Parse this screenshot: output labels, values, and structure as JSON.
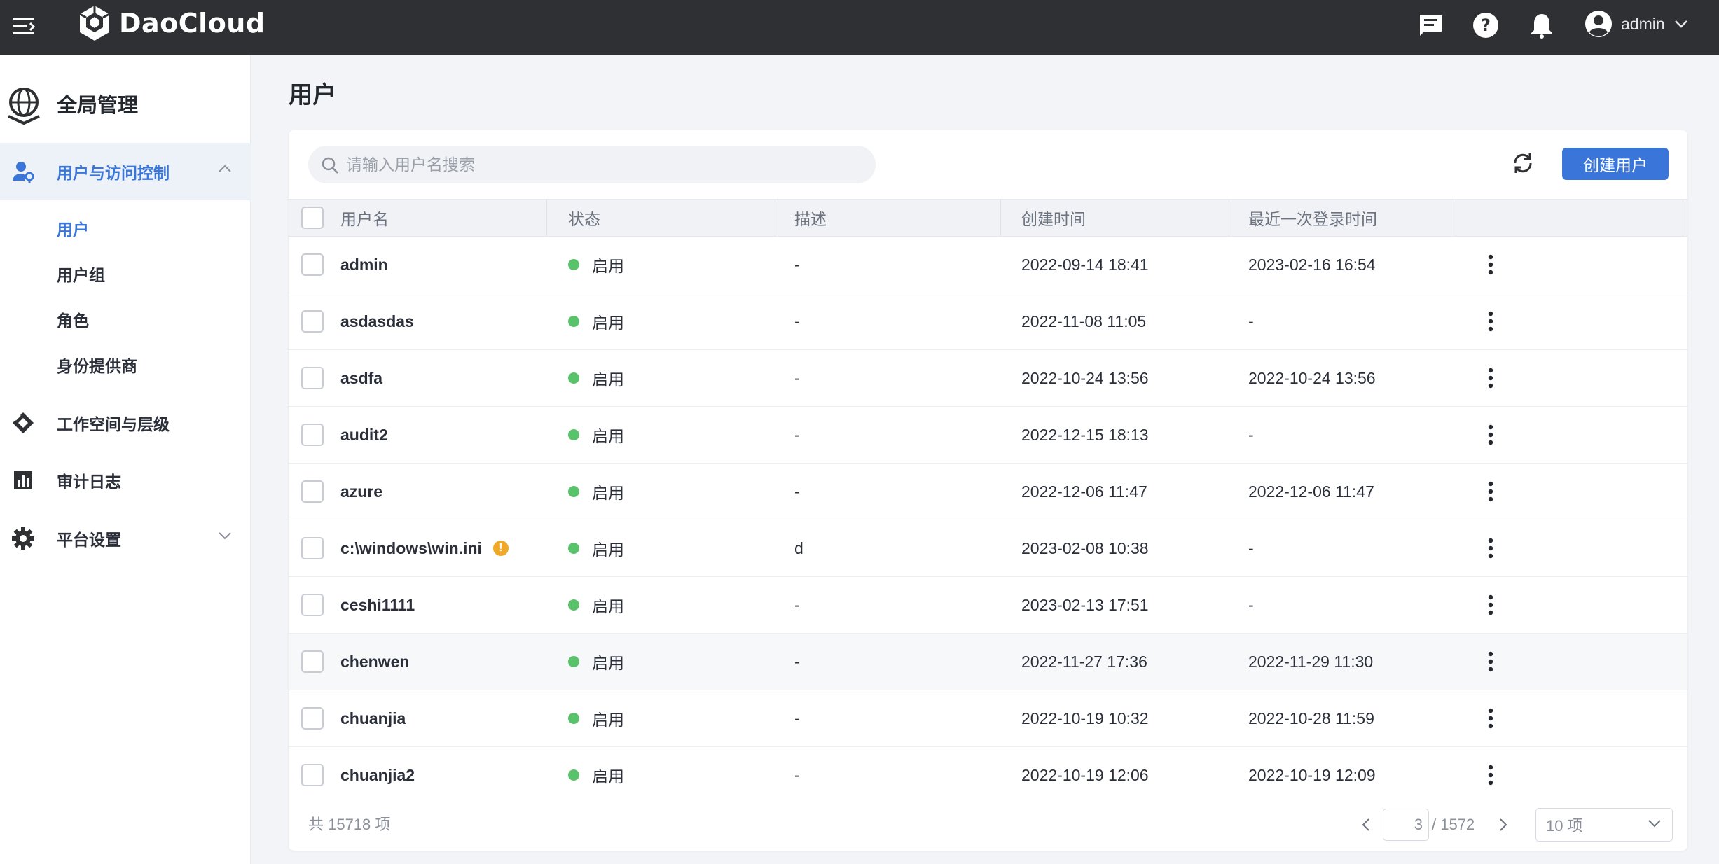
{
  "topbar": {
    "brand": "DaoCloud",
    "icons": [
      "menu-icon",
      "message-icon",
      "help-icon",
      "bell-icon",
      "user-avatar-icon",
      "chevron-down-icon"
    ],
    "user_name": "admin",
    "background": "#2e3033"
  },
  "sidebar": {
    "title": "全局管理",
    "groups": [
      {
        "label": "用户与访问控制",
        "icon": "user-key-icon",
        "expanded": true
      },
      {
        "label": "工作空间与层级",
        "icon": "layers-icon"
      },
      {
        "label": "审计日志",
        "icon": "audit-chart-icon"
      },
      {
        "label": "平台设置",
        "icon": "gear-icon",
        "expanded": false
      }
    ],
    "subitems": [
      "用户",
      "用户组",
      "角色",
      "身份提供商"
    ]
  },
  "page": {
    "title": "用户",
    "search_placeholder": "请输入用户名搜索",
    "create_button": "创建用户",
    "accent": "#3a76d9"
  },
  "table": {
    "columns": [
      "用户名",
      "状态",
      "描述",
      "创建时间",
      "最近一次登录时间"
    ],
    "rows": [
      {
        "name": "admin",
        "status": "启用",
        "desc": "-",
        "created": "2022-09-14 18:41",
        "last_login": "2023-02-16 16:54"
      },
      {
        "name": "asdasdas",
        "status": "启用",
        "desc": "-",
        "created": "2022-11-08 11:05",
        "last_login": "-"
      },
      {
        "name": "asdfa",
        "status": "启用",
        "desc": "-",
        "created": "2022-10-24 13:56",
        "last_login": "2022-10-24 13:56"
      },
      {
        "name": "audit2",
        "status": "启用",
        "desc": "-",
        "created": "2022-12-15 18:13",
        "last_login": "-"
      },
      {
        "name": "azure",
        "status": "启用",
        "desc": "-",
        "created": "2022-12-06 11:47",
        "last_login": "2022-12-06 11:47"
      },
      {
        "name": "c:\\windows\\win.ini",
        "status": "启用",
        "desc": "d",
        "created": "2023-02-08 10:38",
        "last_login": "-",
        "warning": true
      },
      {
        "name": "ceshi1111",
        "status": "启用",
        "desc": "-",
        "created": "2023-02-13 17:51",
        "last_login": "-"
      },
      {
        "name": "chenwen",
        "status": "启用",
        "desc": "-",
        "created": "2022-11-27 17:36",
        "last_login": "2022-11-29 11:30",
        "hovered": true
      },
      {
        "name": "chuanjia",
        "status": "启用",
        "desc": "-",
        "created": "2022-10-19 10:32",
        "last_login": "2022-10-28 11:59"
      },
      {
        "name": "chuanjia2",
        "status": "启用",
        "desc": "-",
        "created": "2022-10-19 12:06",
        "last_login": "2022-10-19 12:09"
      }
    ],
    "status_color": "#5ac26b"
  },
  "footer": {
    "total": "共 15718 项",
    "current_page": "3",
    "total_pages": "/ 1572",
    "page_size": "10 项"
  }
}
